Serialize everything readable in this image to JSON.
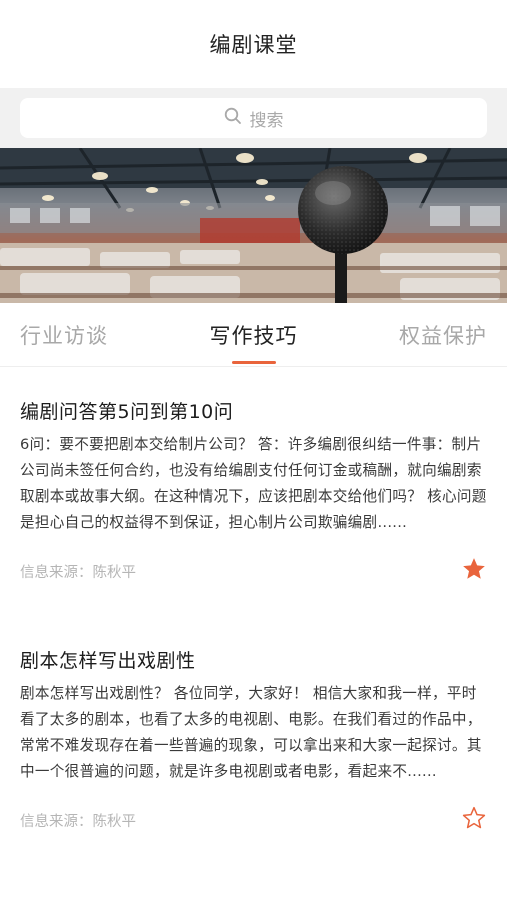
{
  "header": {
    "title": "编剧课堂"
  },
  "search": {
    "placeholder": "搜索"
  },
  "banner": {
    "description_icon": "microphone-banner-image"
  },
  "tabs": [
    {
      "label": "行业访谈",
      "active": false
    },
    {
      "label": "写作技巧",
      "active": true
    },
    {
      "label": "权益保护",
      "active": false
    }
  ],
  "articles": [
    {
      "title": "编剧问答第5问到第10问",
      "excerpt": "6问：要不要把剧本交给制片公司？ 答：许多编剧很纠结一件事：制片公司尚未签任何合约，也没有给编剧支付任何订金或稿酬，就向编剧索取剧本或故事大纲。在这种情况下，应该把剧本交给他们吗？ 核心问题是担心自己的权益得不到保证，担心制片公司欺骗编剧......",
      "source": "信息来源：陈秋平",
      "favorited": true
    },
    {
      "title": "剧本怎样写出戏剧性",
      "excerpt": "剧本怎样写出戏剧性？ 各位同学，大家好！ 相信大家和我一样，平时看了太多的剧本，也看了太多的电视剧、电影。在我们看过的作品中，常常不难发现存在着一些普遍的现象，可以拿出来和大家一起探讨。其中一个很普遍的问题，就是许多电视剧或者电影，看起来不......",
      "source": "信息来源：陈秋平",
      "favorited": false
    }
  ],
  "colors": {
    "accent": "#e9643c",
    "muted": "#b5b5b5"
  }
}
